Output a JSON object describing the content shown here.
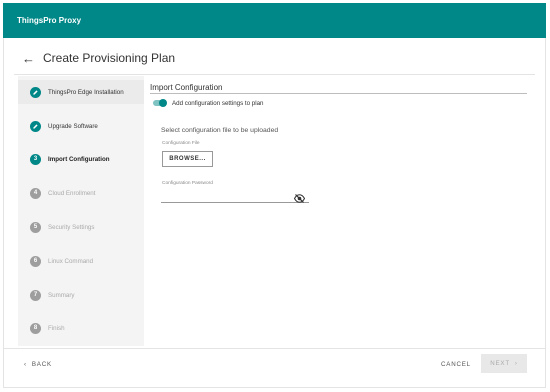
{
  "app": {
    "title": "ThingsPro Proxy",
    "accent": "#008787"
  },
  "header": {
    "back_icon": "arrow-left-icon",
    "title": "Create Provisioning Plan"
  },
  "steps": [
    {
      "icon": "check",
      "label": "ThingsPro Edge Installation",
      "state": "done"
    },
    {
      "icon": "check",
      "label": "Upgrade Software",
      "state": "done"
    },
    {
      "icon": "3",
      "label": "Import Configuration",
      "state": "active"
    },
    {
      "icon": "4",
      "label": "Cloud Enrollment",
      "state": "pending"
    },
    {
      "icon": "5",
      "label": "Security Settings",
      "state": "pending"
    },
    {
      "icon": "6",
      "label": "Linux Command",
      "state": "pending"
    },
    {
      "icon": "7",
      "label": "Summary",
      "state": "pending"
    },
    {
      "icon": "8",
      "label": "Finish",
      "state": "pending"
    }
  ],
  "content": {
    "section_title": "Import Configuration",
    "toggle": {
      "label": "Add configuration settings to plan",
      "on": true
    },
    "upload_heading": "Select configuration file to be uploaded",
    "file_caption": "Configuration File",
    "browse_label": "BROWSE...",
    "password_caption": "Configuration Password",
    "password_value": "",
    "password_icon": "eye-off-icon"
  },
  "footer": {
    "back_label": "BACK",
    "cancel_label": "CANCEL",
    "next_label": "NEXT"
  }
}
